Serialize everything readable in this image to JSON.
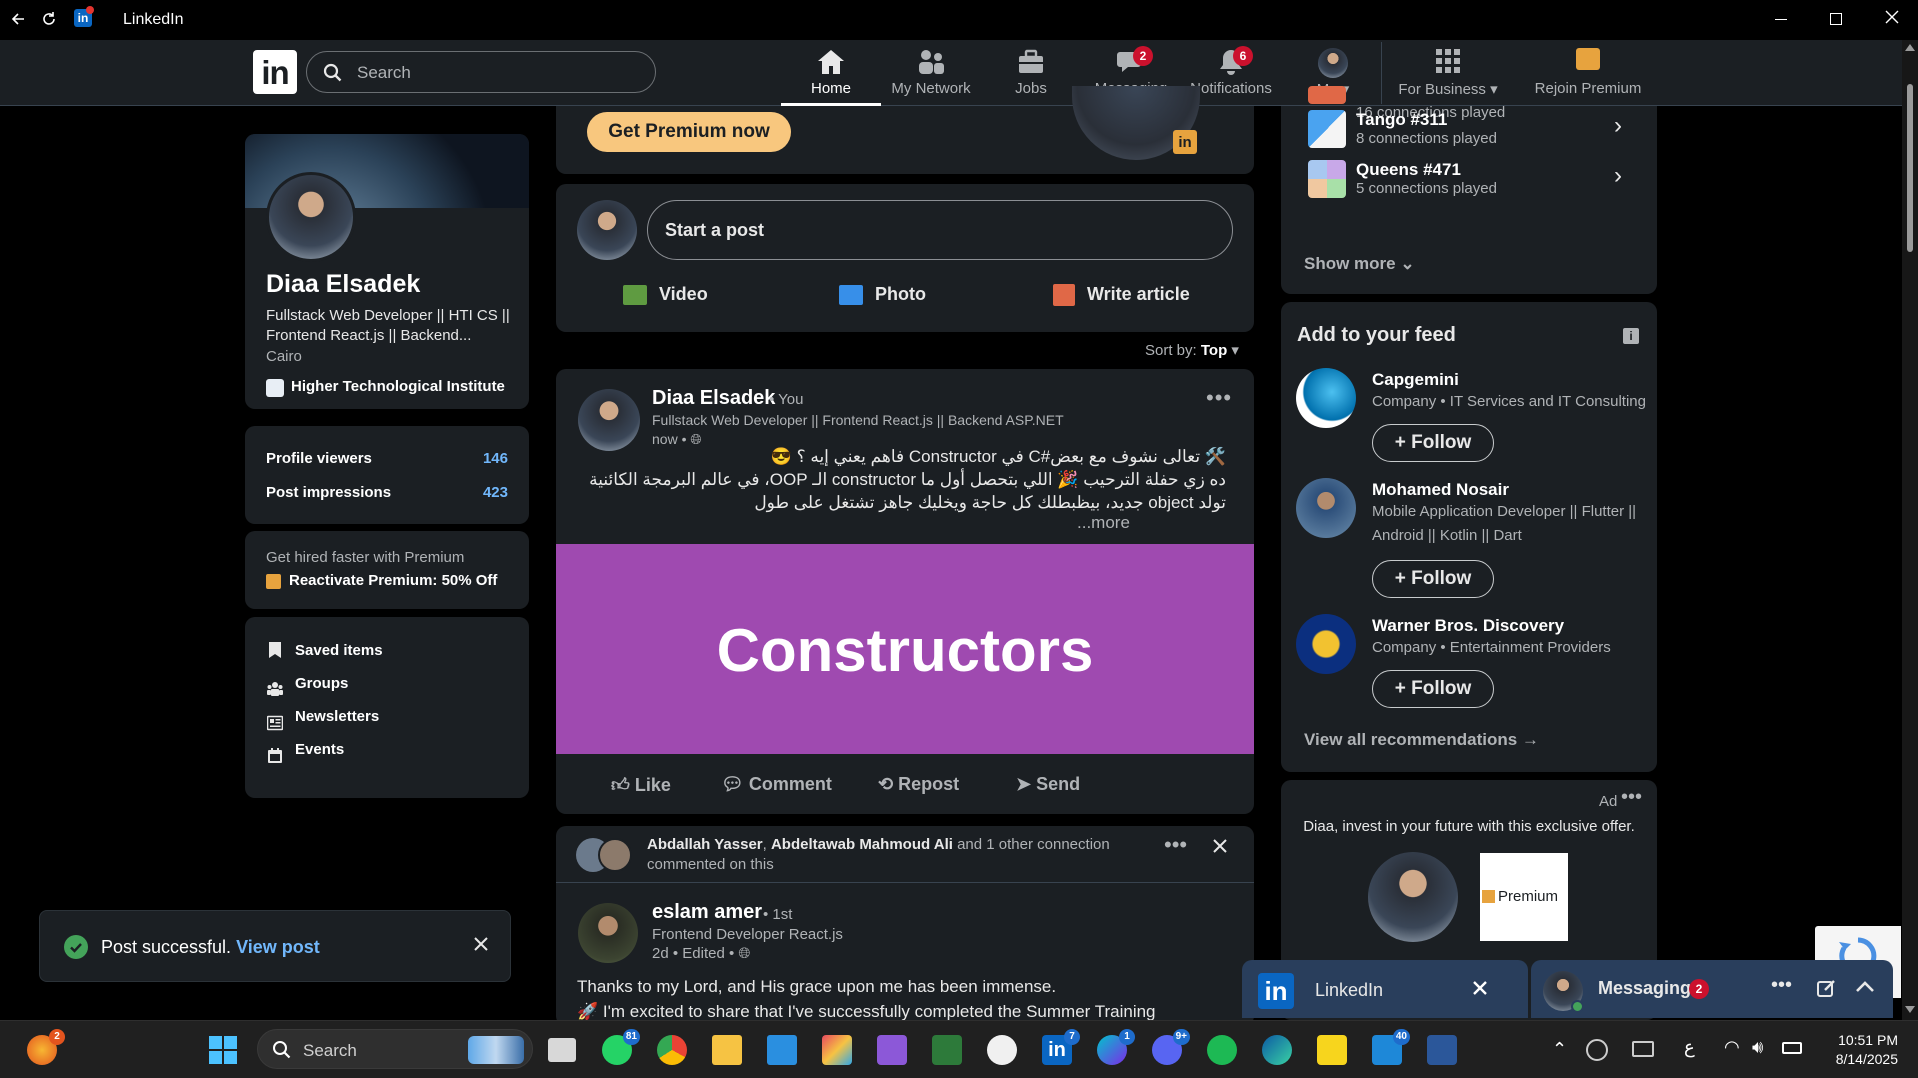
{
  "window": {
    "title": "LinkedIn"
  },
  "nav": {
    "search_placeholder": "Search",
    "home": "Home",
    "network": "My Network",
    "jobs": "Jobs",
    "messaging": "Messaging",
    "messaging_badge": "2",
    "notifications": "Notifications",
    "notifications_badge": "6",
    "me": "Me",
    "for_business": "For Business",
    "rejoin_premium": "Rejoin Premium"
  },
  "profile": {
    "name": "Diaa Elsadek",
    "headline": "Fullstack Web Developer || HTI CS || Frontend React.js || Backend...",
    "location": "Cairo",
    "school": "Higher Technological Institute",
    "stats": [
      {
        "label": "Profile viewers",
        "value": "146"
      },
      {
        "label": "Post impressions",
        "value": "423"
      }
    ],
    "premium_teaser": "Get hired faster with Premium",
    "premium_link": "Reactivate Premium: 50% Off",
    "links": [
      "Saved items",
      "Groups",
      "Newsletters",
      "Events"
    ]
  },
  "toast": {
    "message": "Post successful.",
    "link": "View post"
  },
  "feed": {
    "get_premium": "Get Premium now",
    "start_post": "Start a post",
    "actions": [
      "Video",
      "Photo",
      "Write article"
    ],
    "sort_label": "Sort by:",
    "sort_value": "Top",
    "post1": {
      "author": "Diaa Elsadek",
      "you": "• You",
      "headline": "Fullstack Web Developer || Frontend React.js || Backend ASP.NET",
      "time": "now •",
      "line1": "🛠️ تعالى نشوف مع بعض#C في Constructor فاهم يعني إيه ؟ 😎",
      "line2": "ده زي حفلة الترحيب 🎉 اللي بتحصل أول ما constructor الـ OOP، في عالم البرمجة الكائنية",
      "line3": "تولد object جديد، بيظبطلك كل حاجة ويخليك جاهز تشتغل على طول",
      "more": "...more",
      "image_text": "Constructors",
      "actions": [
        "Like",
        "Comment",
        "Repost",
        "Send"
      ]
    },
    "post2": {
      "who_1": "Abdallah Yasser",
      "who_2": "Abdeltawab Mahmoud Ali",
      "who_rest": "and 1 other connection",
      "commented": "commented on this",
      "author": "eslam amer",
      "degree": "• 1st",
      "headline": "Frontend Developer React.js",
      "time": "2d • Edited •",
      "line1": "Thanks to my Lord, and His grace upon me has been immense.",
      "line2": "🚀 I'm excited to share that I've successfully completed the Summer Training"
    }
  },
  "games": {
    "top_sub": "16 connections played",
    "items": [
      {
        "title": "Tango #311",
        "sub": "8 connections played"
      },
      {
        "title": "Queens #471",
        "sub": "5 connections played"
      }
    ],
    "show_more": "Show more"
  },
  "add_feed": {
    "title": "Add to your feed",
    "items": [
      {
        "name": "Capgemini",
        "sub": "Company • IT Services and IT Consulting"
      },
      {
        "name": "Mohamed Nosair",
        "sub": "Mobile Application Developer || Flutter || Android || Kotlin || Dart"
      },
      {
        "name": "Warner Bros. Discovery",
        "sub": "Company • Entertainment Providers"
      }
    ],
    "follow": "Follow",
    "view_all": "View all recommendations →"
  },
  "ad": {
    "label": "Ad",
    "text": "Diaa, invest in your future with this exclusive offer.",
    "premium": "Premium"
  },
  "messaging_bars": {
    "linkedin": "LinkedIn",
    "messaging": "Messaging",
    "badge": "2"
  },
  "taskbar": {
    "search": "Search",
    "time": "10:51 PM",
    "date": "8/14/2025",
    "lang": "ع",
    "badges": {
      "weather": "2",
      "whatsapp": "81",
      "linkedin": "7",
      "canva": "1",
      "discord": "9+",
      "store": "40"
    }
  },
  "colors": {
    "accent": "#71b7fb",
    "card": "#1b1f23",
    "premium": "#f8c77e",
    "badge": "#cb112d",
    "post_image": "#9f4ab0"
  }
}
